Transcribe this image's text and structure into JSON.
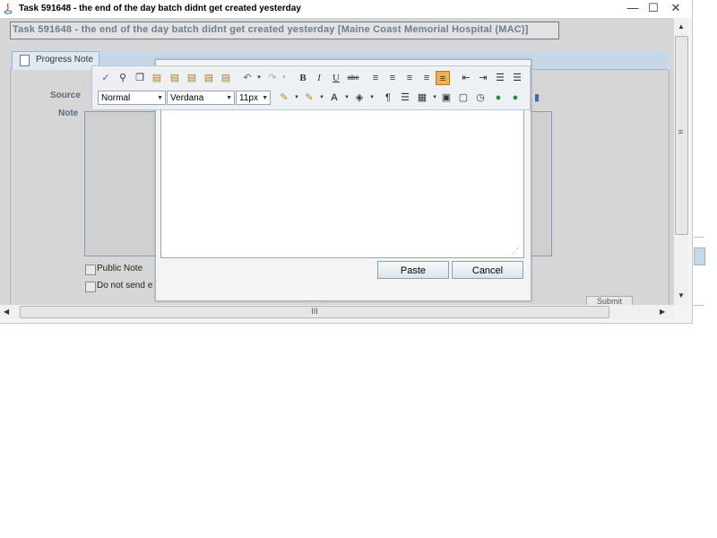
{
  "window": {
    "title": "Task 591648 - the end of the day batch didnt get created yesterday",
    "controls": {
      "minimize": "—",
      "maximize": "☐",
      "close": "✕"
    }
  },
  "task": {
    "header": "Task 591648 - the end of the day batch didnt get created yesterday [Maine Coast Memorial Hospital (MAC)]"
  },
  "tabs": [
    {
      "label": "Progress Note"
    }
  ],
  "form": {
    "source_label": "Source",
    "note_label": "Note",
    "public_note_label": "Public Note",
    "do_not_send_label": "Do not send e",
    "submit_label": "Submit"
  },
  "toolbar": {
    "format_select": "Normal",
    "font_select": "Verdana",
    "size_select": "11px"
  },
  "dialog": {
    "paste_label": "Paste",
    "cancel_label": "Cancel"
  },
  "scrollbars": {
    "up": "▲",
    "down": "▼",
    "left": "◀",
    "right": "▶",
    "grip_v": "≡",
    "grip_h": "III"
  }
}
